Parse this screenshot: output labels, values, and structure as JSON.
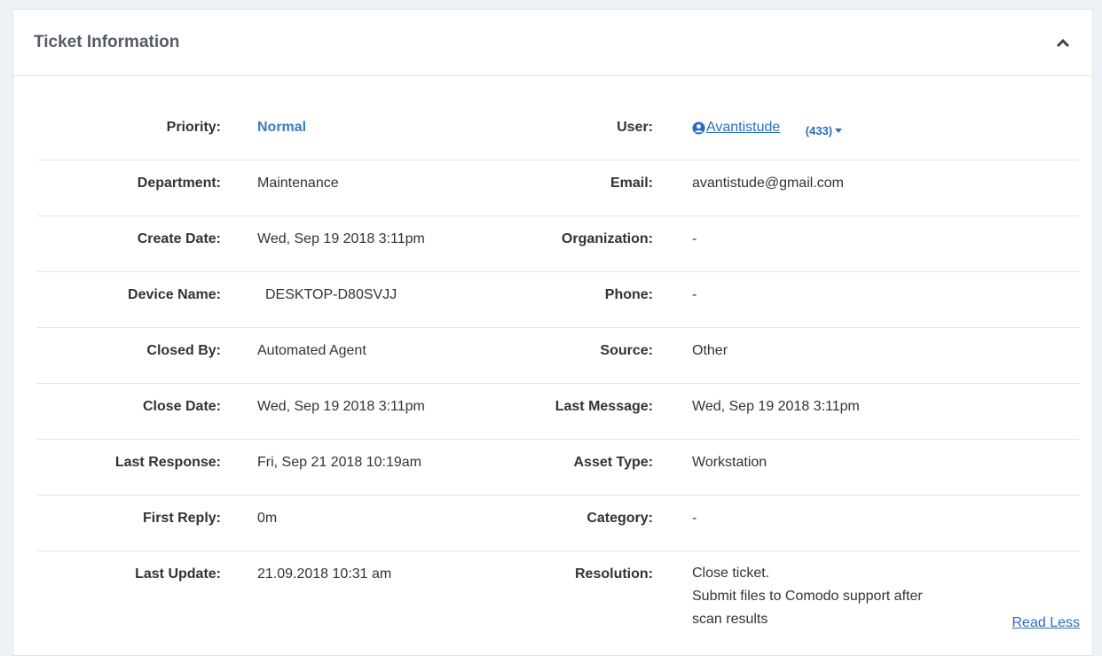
{
  "panel": {
    "title": "Ticket Information"
  },
  "rows": [
    {
      "left_label": "Priority:",
      "left_value": "Normal",
      "right_label": "User:",
      "right_value": "Avantistude",
      "right_extra": "(433)"
    },
    {
      "left_label": "Department:",
      "left_value": "Maintenance",
      "right_label": "Email:",
      "right_value": "avantistude@gmail.com"
    },
    {
      "left_label": "Create Date:",
      "left_value": "Wed, Sep 19 2018 3:11pm",
      "right_label": "Organization:",
      "right_value": "-"
    },
    {
      "left_label": "Device Name:",
      "left_value": "DESKTOP-D80SVJJ",
      "right_label": "Phone:",
      "right_value": "-"
    },
    {
      "left_label": "Closed By:",
      "left_value": "Automated Agent",
      "right_label": "Source:",
      "right_value": "Other"
    },
    {
      "left_label": "Close Date:",
      "left_value": "Wed, Sep 19 2018 3:11pm",
      "right_label": "Last Message:",
      "right_value": "Wed, Sep 19 2018 3:11pm"
    },
    {
      "left_label": "Last Response:",
      "left_value": "Fri, Sep 21 2018 10:19am",
      "right_label": "Asset Type:",
      "right_value": "Workstation"
    },
    {
      "left_label": "First Reply:",
      "left_value": "0m",
      "right_label": "Category:",
      "right_value": "-"
    },
    {
      "left_label": "Last Update:",
      "left_value": "21.09.2018 10:31 am",
      "right_label": "Resolution:",
      "resolution_lines": [
        "Close ticket.",
        "Submit files to Comodo support after",
        "scan results"
      ],
      "read_less": "Read Less"
    }
  ],
  "icons": {
    "collapse": "chevron-up-icon",
    "user": "user-circle-icon",
    "dropdown": "caret-down-icon"
  },
  "colors": {
    "link": "#2a6ebb",
    "priority": "#3b7cc6"
  }
}
